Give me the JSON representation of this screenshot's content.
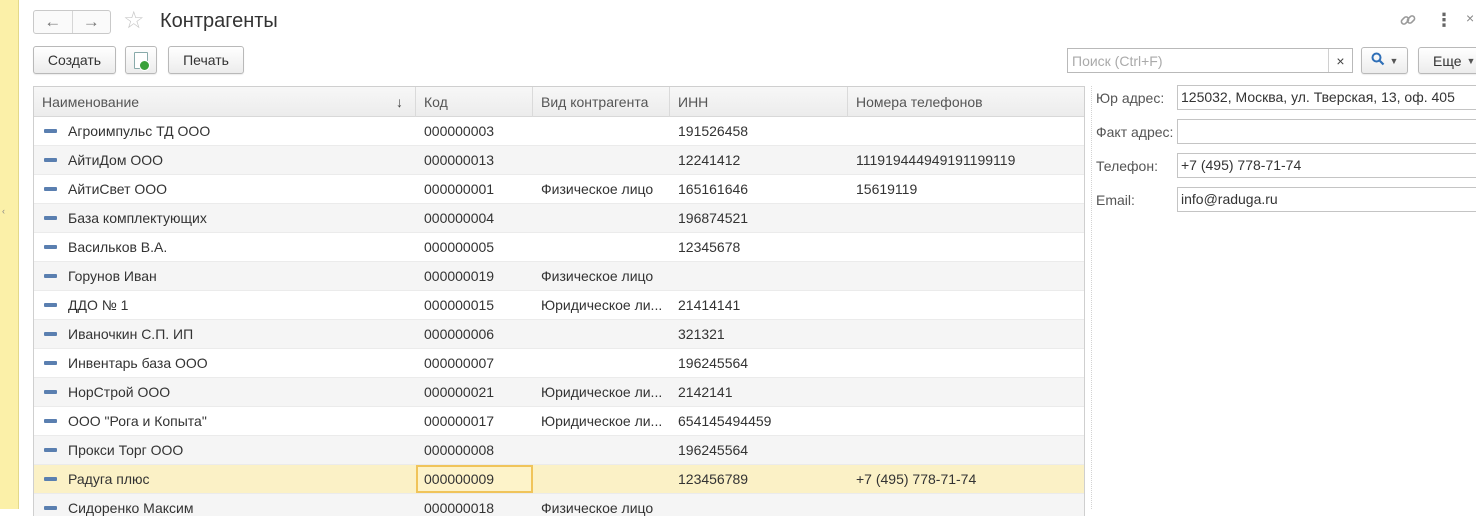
{
  "window": {
    "title": "Контрагенты",
    "header_icons": [
      "link-icon",
      "more-vertical-icon",
      "close-icon"
    ]
  },
  "toolbar": {
    "create_label": "Создать",
    "print_label": "Печать",
    "search_placeholder": "Поиск (Ctrl+F)",
    "search_clear": "×",
    "more_label": "Еще"
  },
  "table": {
    "columns": [
      "Наименование",
      "Код",
      "Вид контрагента",
      "ИНН",
      "Номера телефонов"
    ],
    "sort_indicator": "↓",
    "rows": [
      {
        "name": "Агроимпульс ТД ООО",
        "code": "000000003",
        "type": "",
        "inn": "191526458",
        "phones": ""
      },
      {
        "name": "АйтиДом ООО",
        "code": "000000013",
        "type": "",
        "inn": "12241412",
        "phones": "111919444949191199119"
      },
      {
        "name": "АйтиСвет ООО",
        "code": "000000001",
        "type": "Физическое лицо",
        "inn": "165161646",
        "phones": "15619119"
      },
      {
        "name": "База комплектующих",
        "code": "000000004",
        "type": "",
        "inn": "196874521",
        "phones": ""
      },
      {
        "name": "Васильков В.А.",
        "code": "000000005",
        "type": "",
        "inn": "12345678",
        "phones": ""
      },
      {
        "name": "Горунов Иван",
        "code": "000000019",
        "type": "Физическое лицо",
        "inn": "",
        "phones": ""
      },
      {
        "name": "ДДО № 1",
        "code": "000000015",
        "type": "Юридическое ли...",
        "inn": "21414141",
        "phones": ""
      },
      {
        "name": "Иваночкин С.П. ИП",
        "code": "000000006",
        "type": "",
        "inn": "321321",
        "phones": ""
      },
      {
        "name": "Инвентарь база ООО",
        "code": "000000007",
        "type": "",
        "inn": "196245564",
        "phones": ""
      },
      {
        "name": "НорСтрой ООО",
        "code": "000000021",
        "type": "Юридическое ли...",
        "inn": "2142141",
        "phones": ""
      },
      {
        "name": "ООО \"Рога и Копыта\"",
        "code": "000000017",
        "type": "Юридическое ли...",
        "inn": "654145494459",
        "phones": ""
      },
      {
        "name": "Прокси Торг ООО",
        "code": "000000008",
        "type": "",
        "inn": "196245564",
        "phones": ""
      },
      {
        "name": "Радуга плюс",
        "code": "000000009",
        "type": "",
        "inn": "123456789",
        "phones": "+7 (495) 778-71-74",
        "selected": true
      },
      {
        "name": "Сидоренко Максим",
        "code": "000000018",
        "type": "Физическое лицо",
        "inn": "",
        "phones": ""
      }
    ]
  },
  "details": {
    "legal_address_label": "Юр адрес:",
    "legal_address": "125032, Москва, ул. Тверская, 13, оф. 405",
    "actual_address_label": "Факт адрес:",
    "actual_address": "",
    "phone_label": "Телефон:",
    "phone": "+7 (495) 778-71-74",
    "email_label": "Email:",
    "email": "info@raduga.ru"
  },
  "colors": {
    "selected_row": "#fbf1c6",
    "focus_outline": "#f0c45a",
    "left_strip": "#fbf0a8",
    "row_icon": "#5a7fb0"
  }
}
